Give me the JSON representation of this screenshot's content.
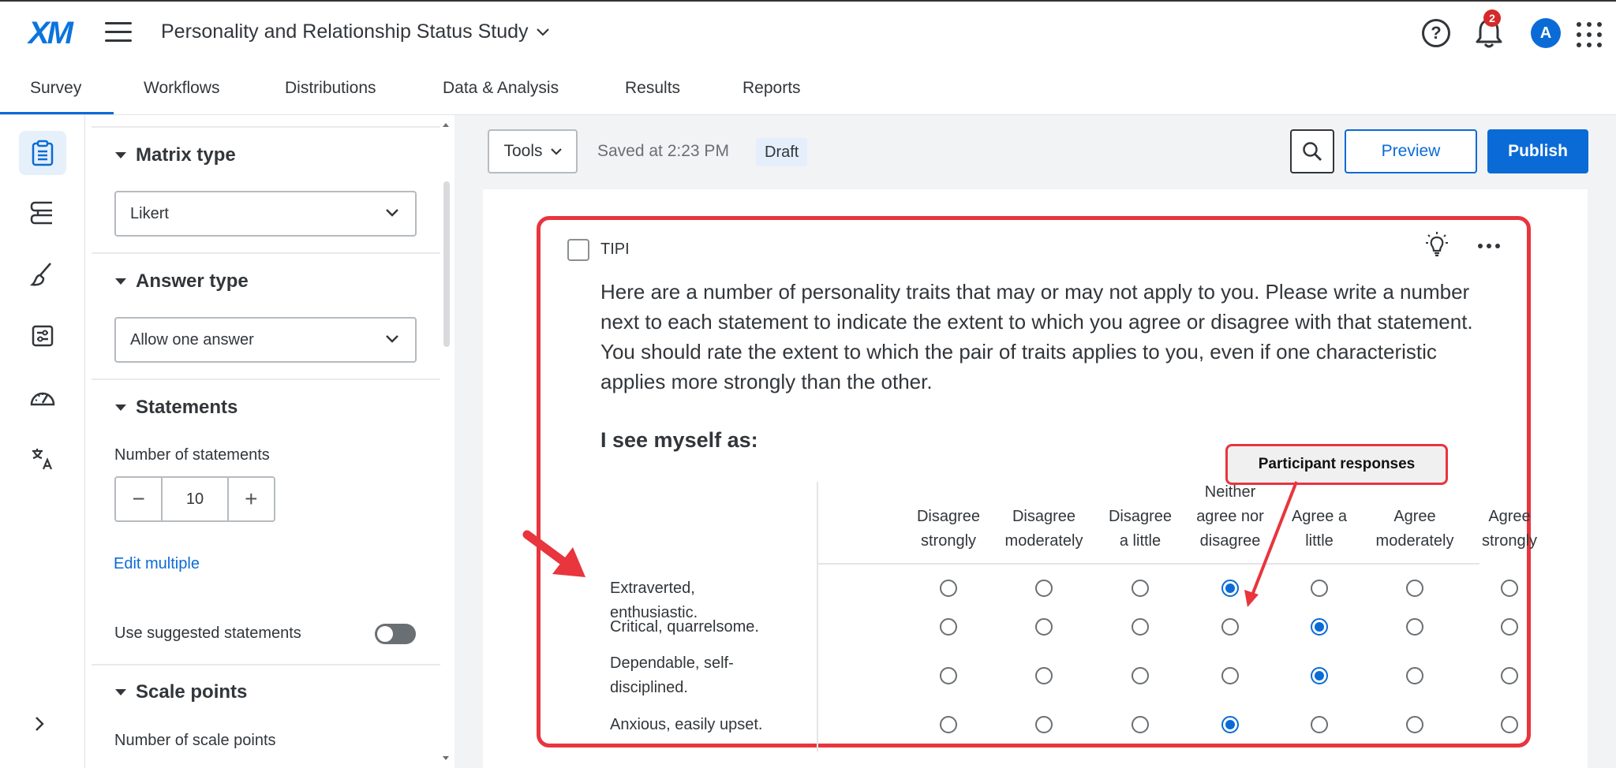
{
  "header": {
    "logo": "XM",
    "project_title": "Personality and Relationship Status Study",
    "help_symbol": "?",
    "notification_count": "2",
    "avatar_initial": "A"
  },
  "tabs": [
    {
      "label": "Survey",
      "active": true
    },
    {
      "label": "Workflows"
    },
    {
      "label": "Distributions"
    },
    {
      "label": "Data & Analysis"
    },
    {
      "label": "Results"
    },
    {
      "label": "Reports"
    }
  ],
  "rail_icons": [
    "survey-icon",
    "blocks-flow-icon",
    "look-and-feel-icon",
    "survey-options-icon",
    "survey-checker-icon",
    "translate-icon"
  ],
  "editor": {
    "matrix_type": {
      "title": "Matrix type",
      "value": "Likert"
    },
    "answer_type": {
      "title": "Answer type",
      "value": "Allow one answer"
    },
    "statements": {
      "title": "Statements",
      "count_label": "Number of statements",
      "count": "10",
      "minus": "−",
      "plus": "+",
      "edit_multiple": "Edit multiple",
      "suggested_label": "Use suggested statements"
    },
    "scale_points": {
      "title": "Scale points",
      "count_label": "Number of scale points"
    }
  },
  "toolbar": {
    "tools_label": "Tools",
    "saved_text": "Saved at 2:23 PM",
    "draft_label": "Draft",
    "preview_label": "Preview",
    "publish_label": "Publish"
  },
  "question": {
    "id": "TIPI",
    "text": "Here are a number of personality traits that may or may not apply to you. Please write a number next to each statement to indicate the extent to which you agree or disagree with that statement. You should rate the extent to which the pair of traits applies to you, even if one characteristic applies more strongly than the other.",
    "subheading": "I see myself as:",
    "columns": [
      [
        "Disagree",
        "strongly"
      ],
      [
        "Disagree",
        "moderately"
      ],
      [
        "Disagree",
        "a little"
      ],
      [
        "Neither",
        "agree nor",
        "disagree"
      ],
      [
        "Agree a",
        "little"
      ],
      [
        "Agree",
        "moderately"
      ],
      [
        "Agree",
        "strongly"
      ]
    ],
    "rows": [
      {
        "label": "Extraverted, enthusiastic.",
        "selected": 3
      },
      {
        "label": "Critical, quarrelsome.",
        "selected": 4
      },
      {
        "label": "Dependable, self-disciplined.",
        "selected": 4
      },
      {
        "label": "Anxious, easily upset.",
        "selected": 3
      }
    ]
  },
  "annotation": {
    "callout_text": "Participant responses",
    "color": "#e8353e"
  },
  "colors": {
    "accent": "#0b6bd6",
    "annotation_red": "#e8353e"
  }
}
